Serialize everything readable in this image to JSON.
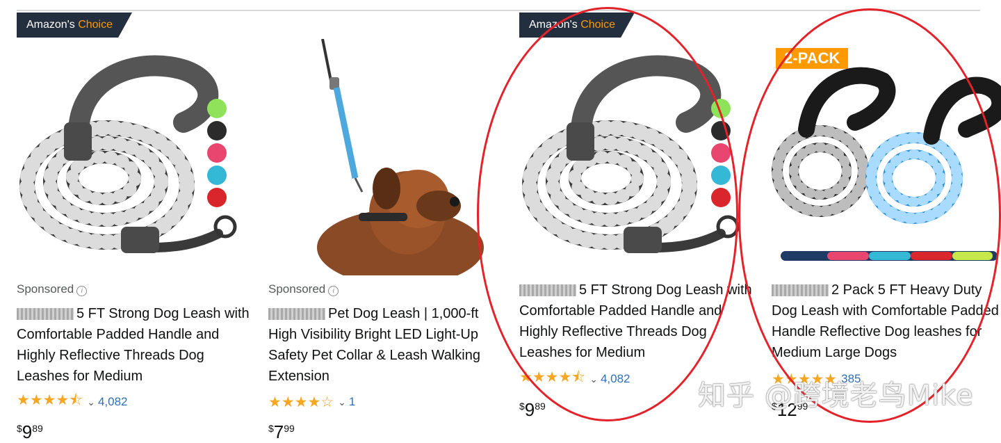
{
  "badges": {
    "amazons": "Amazon's",
    "choice": "Choice",
    "two_pack": "2-PACK"
  },
  "sponsored_label": "Sponsored",
  "info_icon_glyph": "i",
  "products": [
    {
      "sponsored": true,
      "badge": "amazons-choice",
      "title": "5 FT Strong Dog Leash with Comfortable Padded Handle and Highly Reflective Threads Dog Leashes for Medium",
      "stars": "★★★★⯪",
      "rating_value": 4.5,
      "review_count": "4,082",
      "price_symbol": "$",
      "price_whole": "9",
      "price_fraction": "89"
    },
    {
      "sponsored": true,
      "badge": "",
      "title": "Pet Dog Leash | 1,000-ft High Visibility Bright LED Light-Up Safety Pet Collar & Leash Walking Extension",
      "stars": "★★★★☆",
      "rating_value": 4.0,
      "review_count": "1",
      "price_symbol": "$",
      "price_whole": "7",
      "price_fraction": "99"
    },
    {
      "sponsored": false,
      "badge": "amazons-choice",
      "title": "5 FT Strong Dog Leash with Comfortable Padded Handle and Highly Reflective Threads Dog Leashes for Medium",
      "stars": "★★★★⯪",
      "rating_value": 4.5,
      "review_count": "4,082",
      "price_symbol": "$",
      "price_whole": "9",
      "price_fraction": "89"
    },
    {
      "sponsored": false,
      "badge": "2-pack",
      "title": "2 Pack 5 FT Heavy Duty Dog Leash with Comfortable Padded Handle Reflective Dog leashes for Medium Large Dogs",
      "stars": "★★★★★",
      "rating_value": 4.5,
      "review_count": "385",
      "price_symbol": "$",
      "price_whole": "12",
      "price_fraction": "99"
    }
  ],
  "swatch_colors": [
    "#8ee35b",
    "#2b2b2b",
    "#e8466f",
    "#35b8d6",
    "#d8262c"
  ],
  "colors": {
    "star": "#f5a623",
    "link": "#2f6fb8",
    "badge_bg": "#232f3e",
    "choice_orange": "#ff9900",
    "annotation_red": "#e3222a"
  },
  "watermark": "知乎 @跨境老鸟Mike"
}
